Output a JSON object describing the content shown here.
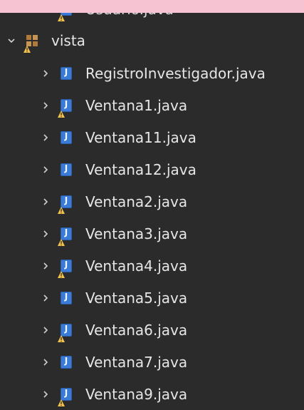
{
  "tree": {
    "clipped_item": {
      "label": "Usuario.java"
    },
    "package": {
      "label": "vista"
    },
    "files": [
      {
        "label": "RegistroInvestigador.java",
        "warning": false
      },
      {
        "label": "Ventana1.java",
        "warning": true
      },
      {
        "label": "Ventana11.java",
        "warning": false
      },
      {
        "label": "Ventana12.java",
        "warning": false
      },
      {
        "label": "Ventana2.java",
        "warning": true
      },
      {
        "label": "Ventana3.java",
        "warning": true
      },
      {
        "label": "Ventana4.java",
        "warning": true
      },
      {
        "label": "Ventana5.java",
        "warning": false
      },
      {
        "label": "Ventana6.java",
        "warning": true
      },
      {
        "label": "Ventana7.java",
        "warning": false
      },
      {
        "label": "Ventana9.java",
        "warning": true
      }
    ]
  },
  "colors": {
    "background": "#2b2b2b",
    "text": "#e6e6e6",
    "java_icon": "#3b7bd6",
    "warning": "#f2c14e",
    "top_band": "#f6c3d2"
  },
  "icons": {
    "collapsed": "chevron-right-icon",
    "expanded": "chevron-down-icon",
    "package": "package-icon",
    "java_file": "java-file-icon",
    "warning": "warning-icon"
  }
}
